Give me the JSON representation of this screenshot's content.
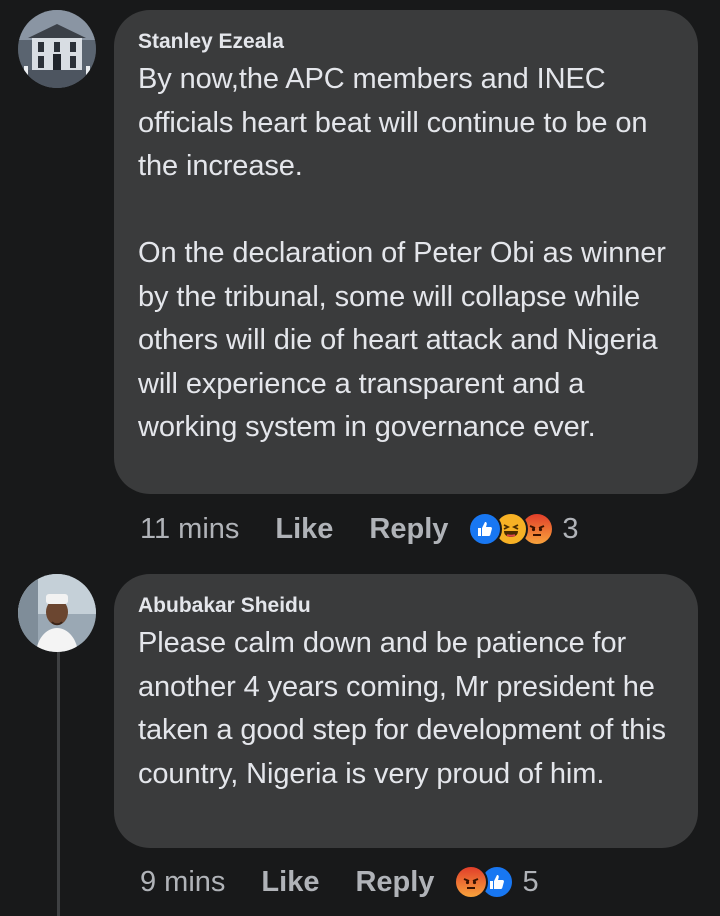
{
  "comments": [
    {
      "author": "Stanley Ezeala",
      "text": "By now,the APC members and INEC officials heart beat will continue to be on the increase.\n\nOn the declaration of Peter Obi as winner by the tribunal, some will collapse while others will die of heart attack and Nigeria will experience a transparent and a working system in governance ever.",
      "time": "11 mins",
      "like_label": "Like",
      "reply_label": "Reply",
      "reactions": [
        "like-reaction-icon",
        "haha-reaction-icon",
        "angry-reaction-icon"
      ],
      "reaction_count": "3"
    },
    {
      "author": "Abubakar Sheidu",
      "text": "Please calm down and be patience for another 4 years coming, Mr president he taken a good step for development of this country, Nigeria is very proud of him.",
      "time": "9 mins",
      "like_label": "Like",
      "reply_label": "Reply",
      "reactions": [
        "angry-reaction-icon",
        "like-reaction-icon"
      ],
      "reaction_count": "5"
    }
  ],
  "colors": {
    "background": "#18191a",
    "bubble": "#3a3b3c",
    "text": "#e4e6eb",
    "secondary_text": "#b0b3b8",
    "like_blue": "#1877f2",
    "angry_orange": "#f0502a",
    "haha_yellow": "#f7b125"
  }
}
